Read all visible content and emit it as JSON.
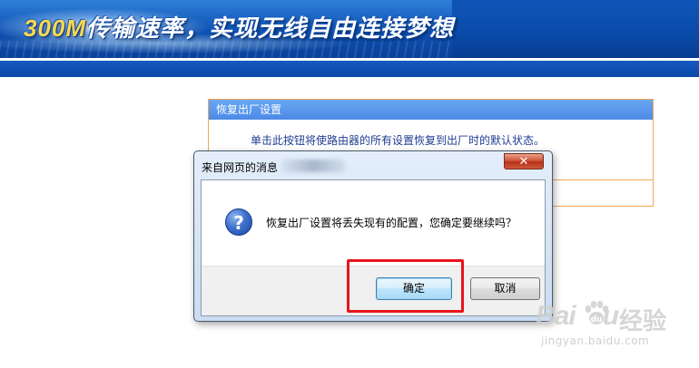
{
  "banner": {
    "speed": "300M",
    "slogan": "传输速率，实现无线自由连接梦想"
  },
  "panel": {
    "title": "恢复出厂设置",
    "description": "单击此按钮将使路由器的所有设置恢复到出厂时的默认状态。"
  },
  "dialog": {
    "title": "来自网页的消息",
    "close_glyph": "✕",
    "icon": "question-icon",
    "message": "恢复出厂设置将丢失现有的配置，您确定要继续吗？",
    "ok_label": "确定",
    "cancel_label": "取消"
  },
  "watermark": {
    "logo_text": "Bai",
    "logo_tail": "u",
    "cn_text": "经验",
    "url": "jingyan.baidu.com"
  },
  "colors": {
    "banner_blue": "#0a4aa8",
    "panel_header": "#5a96ec",
    "panel_border": "#f0a75a",
    "highlight_red": "#e8141c"
  }
}
